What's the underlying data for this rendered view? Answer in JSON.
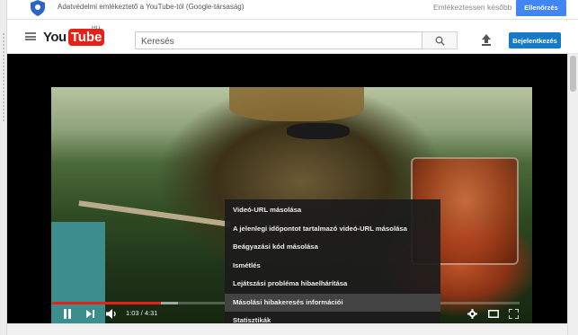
{
  "consent_bar": {
    "text": "Adatvédelmi emlékeztető a YouTube-tól (Google-társaság)",
    "remind_later": "Emlékeztessen később",
    "review_button": "Ellenőrzés"
  },
  "header": {
    "logo_you": "You",
    "logo_tube": "Tube",
    "region": "HU",
    "search_placeholder": "Keresés",
    "signin_label": "Bejelentkezés"
  },
  "player": {
    "time": "1:03 / 4:31",
    "progress_fraction": 0.232,
    "loaded_fraction": 0.27
  },
  "context_menu": {
    "items": [
      "Videó-URL másolása",
      "A jelenlegi időpontot tartalmazó videó-URL másolása",
      "Beágyazási kód másolása",
      "Ismétlés",
      "Lejátszási probléma hibaelhárítása",
      "Másolási hibakeresés információi",
      "Statisztikák"
    ],
    "hovered_index": 5
  },
  "colors": {
    "brand_red": "#e62117",
    "signin_blue": "#167ac6",
    "google_blue": "#4285f4"
  },
  "icons": [
    "shield-icon",
    "menu-icon",
    "search-icon",
    "upload-icon",
    "play-pause-icon",
    "next-icon",
    "volume-icon",
    "settings-icon",
    "theater-mode-icon",
    "fullscreen-icon"
  ]
}
